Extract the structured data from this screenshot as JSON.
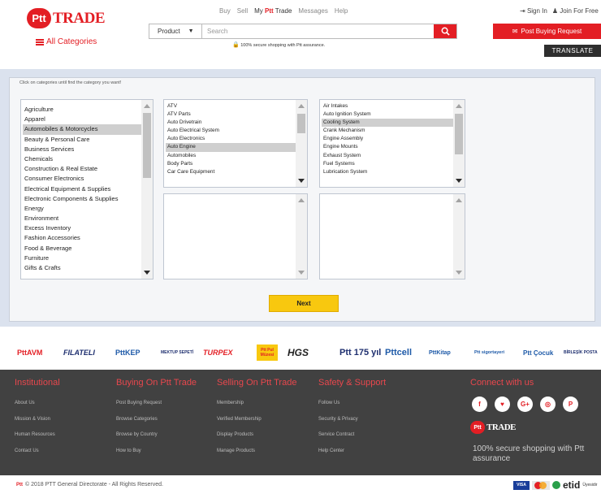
{
  "header": {
    "logo_mark": "Ptt",
    "logo_text": "TRADE",
    "all_categories": "All Categories",
    "nav": [
      "Buy",
      "Sell"
    ],
    "nav_my_prefix": "My",
    "nav_my_brand": "Ptt",
    "nav_my_suffix": "Trade",
    "nav_tail": [
      "Messages",
      "Help"
    ],
    "sign_in": "Sign In",
    "join": "Join For Free",
    "search_category": "Product",
    "search_placeholder": "Search",
    "secure_note": "100% secure shopping with Ptt assurance.",
    "post_buying_request": "Post Buying Request",
    "translate": "TRANSLATE"
  },
  "category_picker": {
    "instruction": "Click on categories until find the category you want!",
    "column1": {
      "items": [
        "Agriculture",
        "Apparel",
        "Automobiles & Motorcycles",
        "Beauty & Personal Care",
        "Business Services",
        "Chemicals",
        "Construction & Real Estate",
        "Consumer Electronics",
        "Electrical Equipment & Supplies",
        "Electronic Components & Supplies",
        "Energy",
        "Environment",
        "Excess Inventory",
        "Fashion Accessories",
        "Food & Beverage",
        "Furniture",
        "Gifts & Crafts"
      ],
      "selected": "Automobiles & Motorcycles"
    },
    "column2": {
      "items": [
        "ATV",
        "ATV Parts",
        "Auto Drivetrain",
        "Auto Electrical System",
        "Auto Electronics",
        "Auto Engine",
        "Automobiles",
        "Body Parts",
        "Car Care Equipment"
      ],
      "selected": "Auto Engine"
    },
    "column3": {
      "items": [
        "Air Intakes",
        "Auto Ignition System",
        "Cooling System",
        "Crank Mechanism",
        "Engine Assembly",
        "Engine Mounts",
        "Exhaust System",
        "Fuel Systems",
        "Lubrication System"
      ],
      "selected": "Cooling System"
    },
    "next_label": "Next"
  },
  "partners": [
    "PttAVM",
    "FILATELI",
    "PttKEP",
    "MEKTUP SEPETİ",
    "TURPEX",
    "Ptt Pul Müzesi",
    "HGS",
    "Ptt 175 yıl",
    "Pttcell",
    "PttKitap",
    "Ptt sigortayeri",
    "Ptt Çocuk",
    "BİRLEŞİK POSTA"
  ],
  "footer": {
    "columns": [
      {
        "title": "Institutional",
        "links": [
          "About Us",
          "Mission & Vision",
          "Human Resources",
          "Contact Us"
        ]
      },
      {
        "title": "Buying On Ptt Trade",
        "links": [
          "Post Buying Request",
          "Browse Categories",
          "Browse by Country",
          "How to Buy"
        ]
      },
      {
        "title": "Selling On Ptt Trade",
        "links": [
          "Membership",
          "Verified Membership",
          "Display Products",
          "Manage Products"
        ]
      },
      {
        "title": "Safety & Support",
        "links": [
          "Follow Us",
          "Security & Privacy",
          "Service Contract",
          "Help Center"
        ]
      }
    ],
    "connect_title": "Connect with us",
    "social_icons": [
      "f",
      "♥",
      "G+",
      "◎",
      "P"
    ],
    "secure_text": "100% secure shopping with Ptt assurance",
    "copyright": "© 2018 PTT General Directorate - All Rights Reserved.",
    "payment": {
      "visa": "VISA",
      "etid": "etid",
      "etid_sub": "Üyesidir"
    }
  },
  "colors": {
    "brand_red": "#e31e24",
    "next_yellow": "#f8c80f",
    "footer_bg": "#414141",
    "panel_bg": "#dbe2ee"
  }
}
